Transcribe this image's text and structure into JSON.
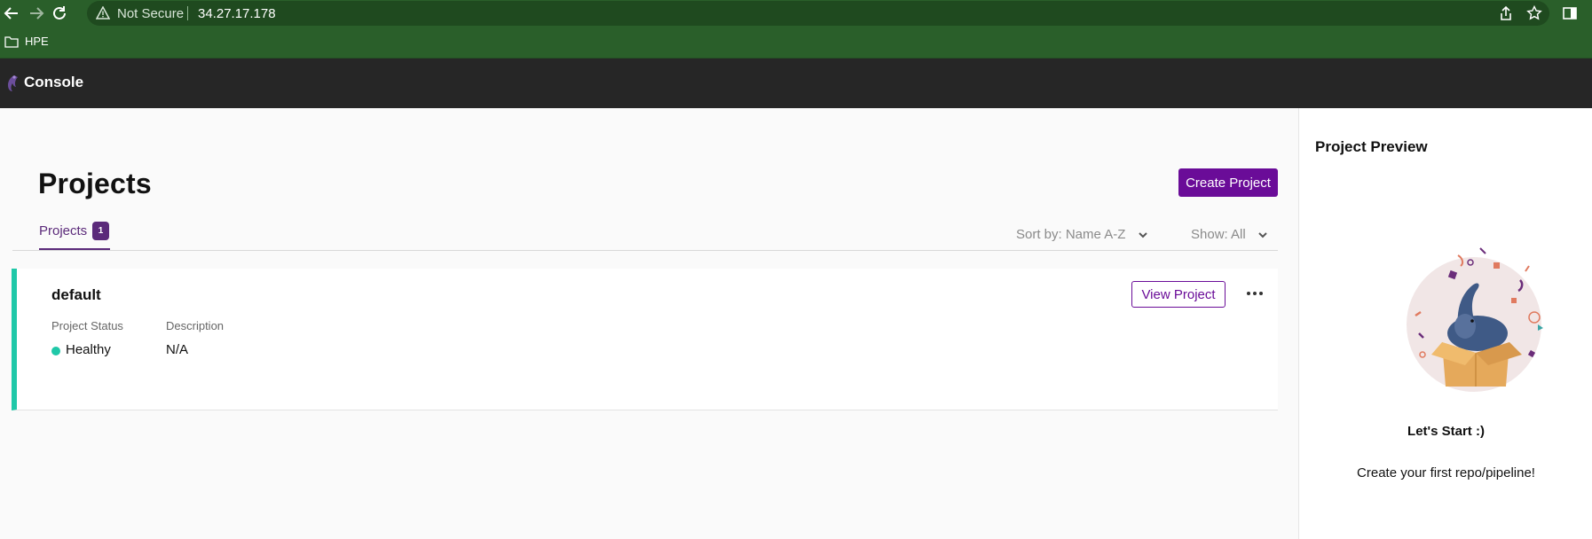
{
  "browser": {
    "security_label": "Not Secure",
    "url": "34.27.17.178",
    "bookmarks": [
      {
        "label": "HPE"
      }
    ],
    "icons": [
      "back-icon",
      "forward-icon",
      "reload-icon",
      "warning-icon",
      "share-icon",
      "star-icon",
      "sidebar-icon"
    ]
  },
  "app": {
    "title": "Console"
  },
  "page": {
    "title": "Projects",
    "create_button": "Create Project",
    "tabs": [
      {
        "label": "Projects",
        "count": "1"
      }
    ],
    "sort_label": "Sort by: Name A-Z",
    "show_label": "Show: All"
  },
  "projects": [
    {
      "name": "default",
      "view_button": "View  Project",
      "status_label": "Project Status",
      "status": "Healthy",
      "description_label": "Description",
      "description": "N/A"
    }
  ],
  "preview": {
    "title": "Project Preview",
    "heading": "Let's Start :)",
    "message": "Create your first repo/pipeline!"
  },
  "colors": {
    "browser_green": "#2a5f2a",
    "app_bar": "#262626",
    "accent_purple": "#6a0c98",
    "healthy_green": "#1fc8a8"
  }
}
